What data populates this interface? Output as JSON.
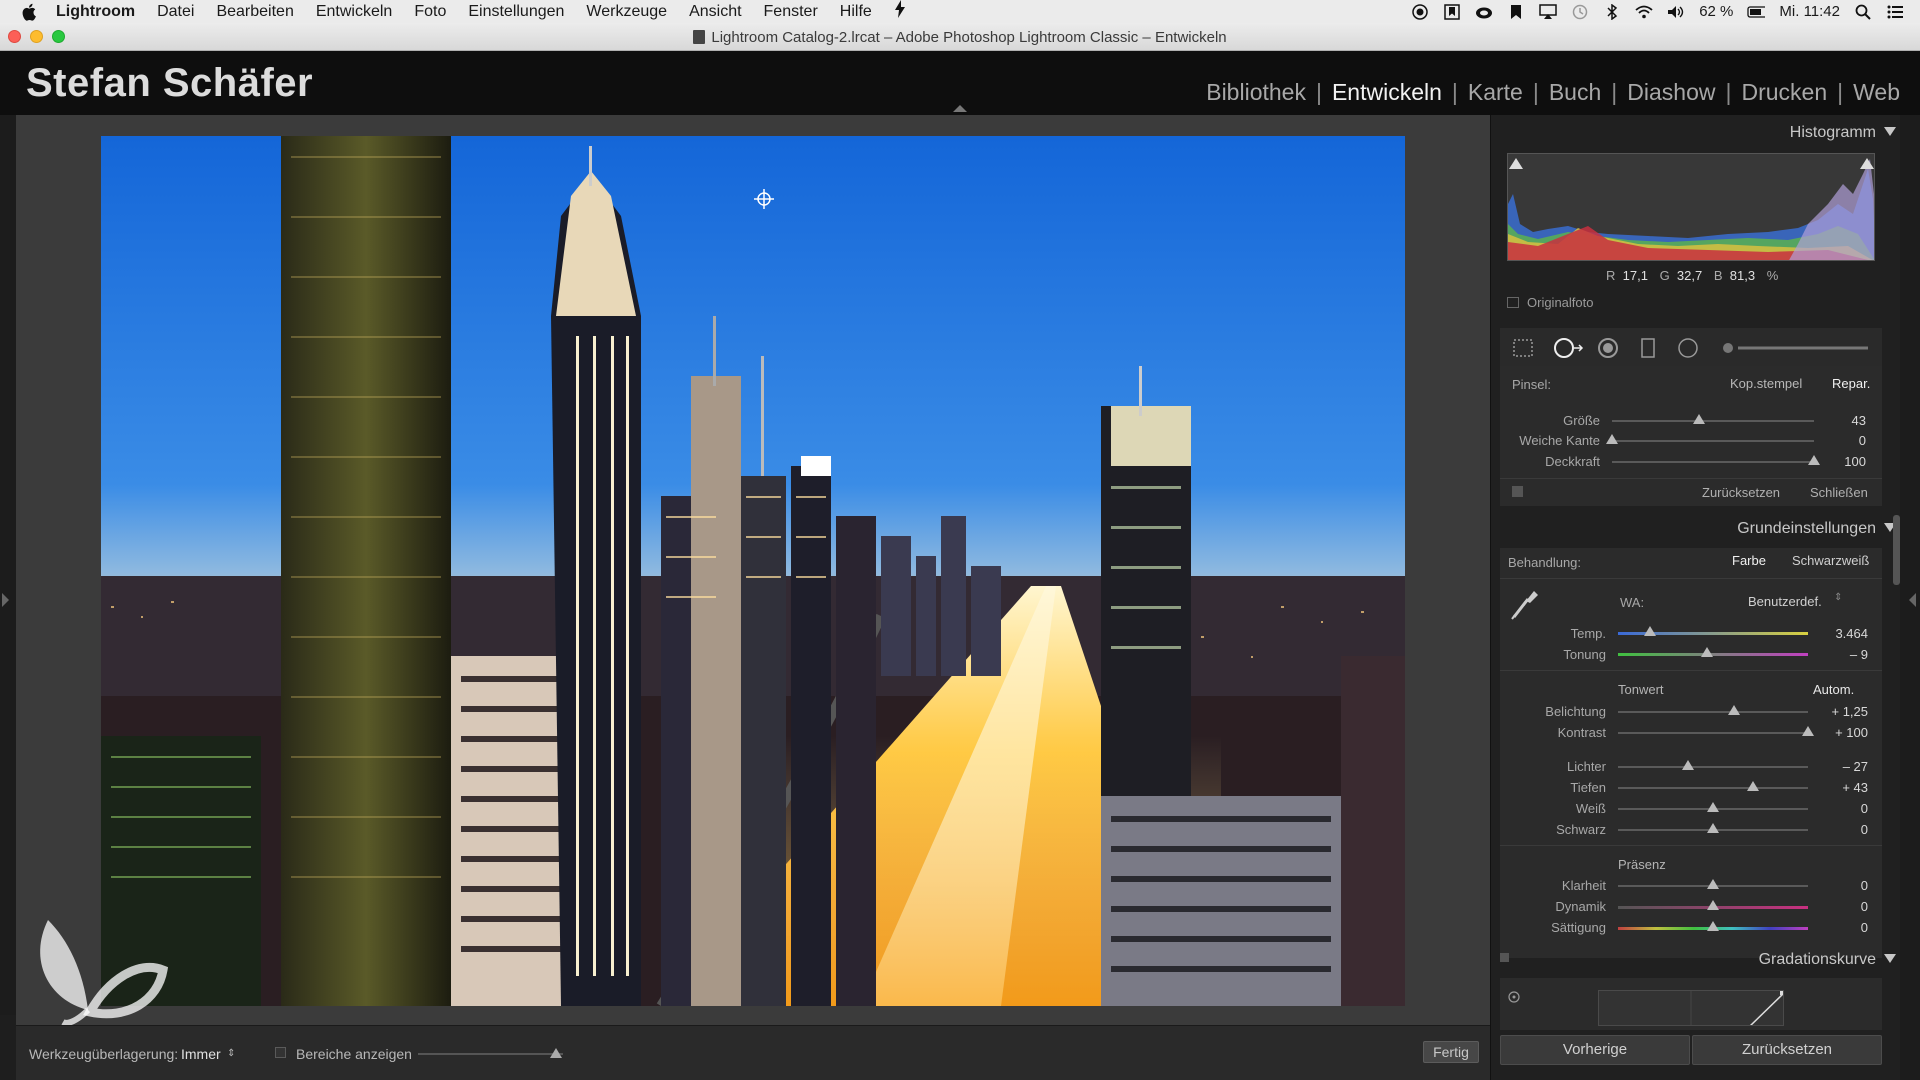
{
  "menubar": {
    "items": [
      "Lightroom",
      "Datei",
      "Bearbeiten",
      "Entwickeln",
      "Foto",
      "Einstellungen",
      "Werkzeuge",
      "Ansicht",
      "Fenster",
      "Hilfe"
    ],
    "battery": "62 %",
    "clock": "Mi. 11:42"
  },
  "window": {
    "title": "Lightroom Catalog-2.lrcat – Adobe Photoshop Lightroom Classic – Entwickeln"
  },
  "header": {
    "identity": "Stefan Schäfer",
    "modules": [
      "Bibliothek",
      "Entwickeln",
      "Karte",
      "Buch",
      "Diashow",
      "Drucken",
      "Web"
    ],
    "active_module": "Entwickeln"
  },
  "toolbar": {
    "overlay_label": "Werkzeugüberlagerung:",
    "overlay_value": "Immer",
    "show_areas_label": "Bereiche anzeigen",
    "done_label": "Fertig"
  },
  "histogram": {
    "title": "Histogramm",
    "r_label": "R",
    "r_value": "17,1",
    "g_label": "G",
    "g_value": "32,7",
    "b_label": "B",
    "b_value": "81,3",
    "unit": "%",
    "original_label": "Originalfoto"
  },
  "brush": {
    "label": "Pinsel:",
    "clone_label": "Kop.stempel",
    "heal_label": "Repar.",
    "sliders": [
      {
        "label": "Größe",
        "value": "43",
        "pos": 0.43
      },
      {
        "label": "Weiche Kante",
        "value": "0",
        "pos": 0.0
      },
      {
        "label": "Deckkraft",
        "value": "100",
        "pos": 1.0
      }
    ],
    "reset_label": "Zurücksetzen",
    "close_label": "Schließen"
  },
  "basic": {
    "title": "Grundeinstellungen",
    "treatment_label": "Behandlung:",
    "color_label": "Farbe",
    "bw_label": "Schwarzweiß",
    "wb_label": "WA:",
    "wb_value": "Benutzerdef.",
    "temp": {
      "label": "Temp.",
      "value": "3.464",
      "pos": 0.17
    },
    "tint": {
      "label": "Tonung",
      "value": "– 9",
      "pos": 0.47
    },
    "tone_label": "Tonwert",
    "auto_label": "Autom.",
    "tone_sliders": [
      {
        "label": "Belichtung",
        "value": "+ 1,25",
        "pos": 0.61
      },
      {
        "label": "Kontrast",
        "value": "+ 100",
        "pos": 1.0
      }
    ],
    "tone_sliders2": [
      {
        "label": "Lichter",
        "value": "– 27",
        "pos": 0.37
      },
      {
        "label": "Tiefen",
        "value": "+ 43",
        "pos": 0.71
      },
      {
        "label": "Weiß",
        "value": "0",
        "pos": 0.5
      },
      {
        "label": "Schwarz",
        "value": "0",
        "pos": 0.5
      }
    ],
    "presence_label": "Präsenz",
    "presence_sliders": [
      {
        "label": "Klarheit",
        "value": "0",
        "pos": 0.5
      },
      {
        "label": "Dynamik",
        "value": "0",
        "pos": 0.5
      },
      {
        "label": "Sättigung",
        "value": "0",
        "pos": 0.5
      }
    ]
  },
  "curve": {
    "title": "Gradationskurve"
  },
  "buttons": {
    "previous_label": "Vorherige",
    "reset_label": "Zurücksetzen"
  },
  "colors": {
    "panel": "#2b2b2b",
    "accent_text": "#f2f2f2"
  }
}
